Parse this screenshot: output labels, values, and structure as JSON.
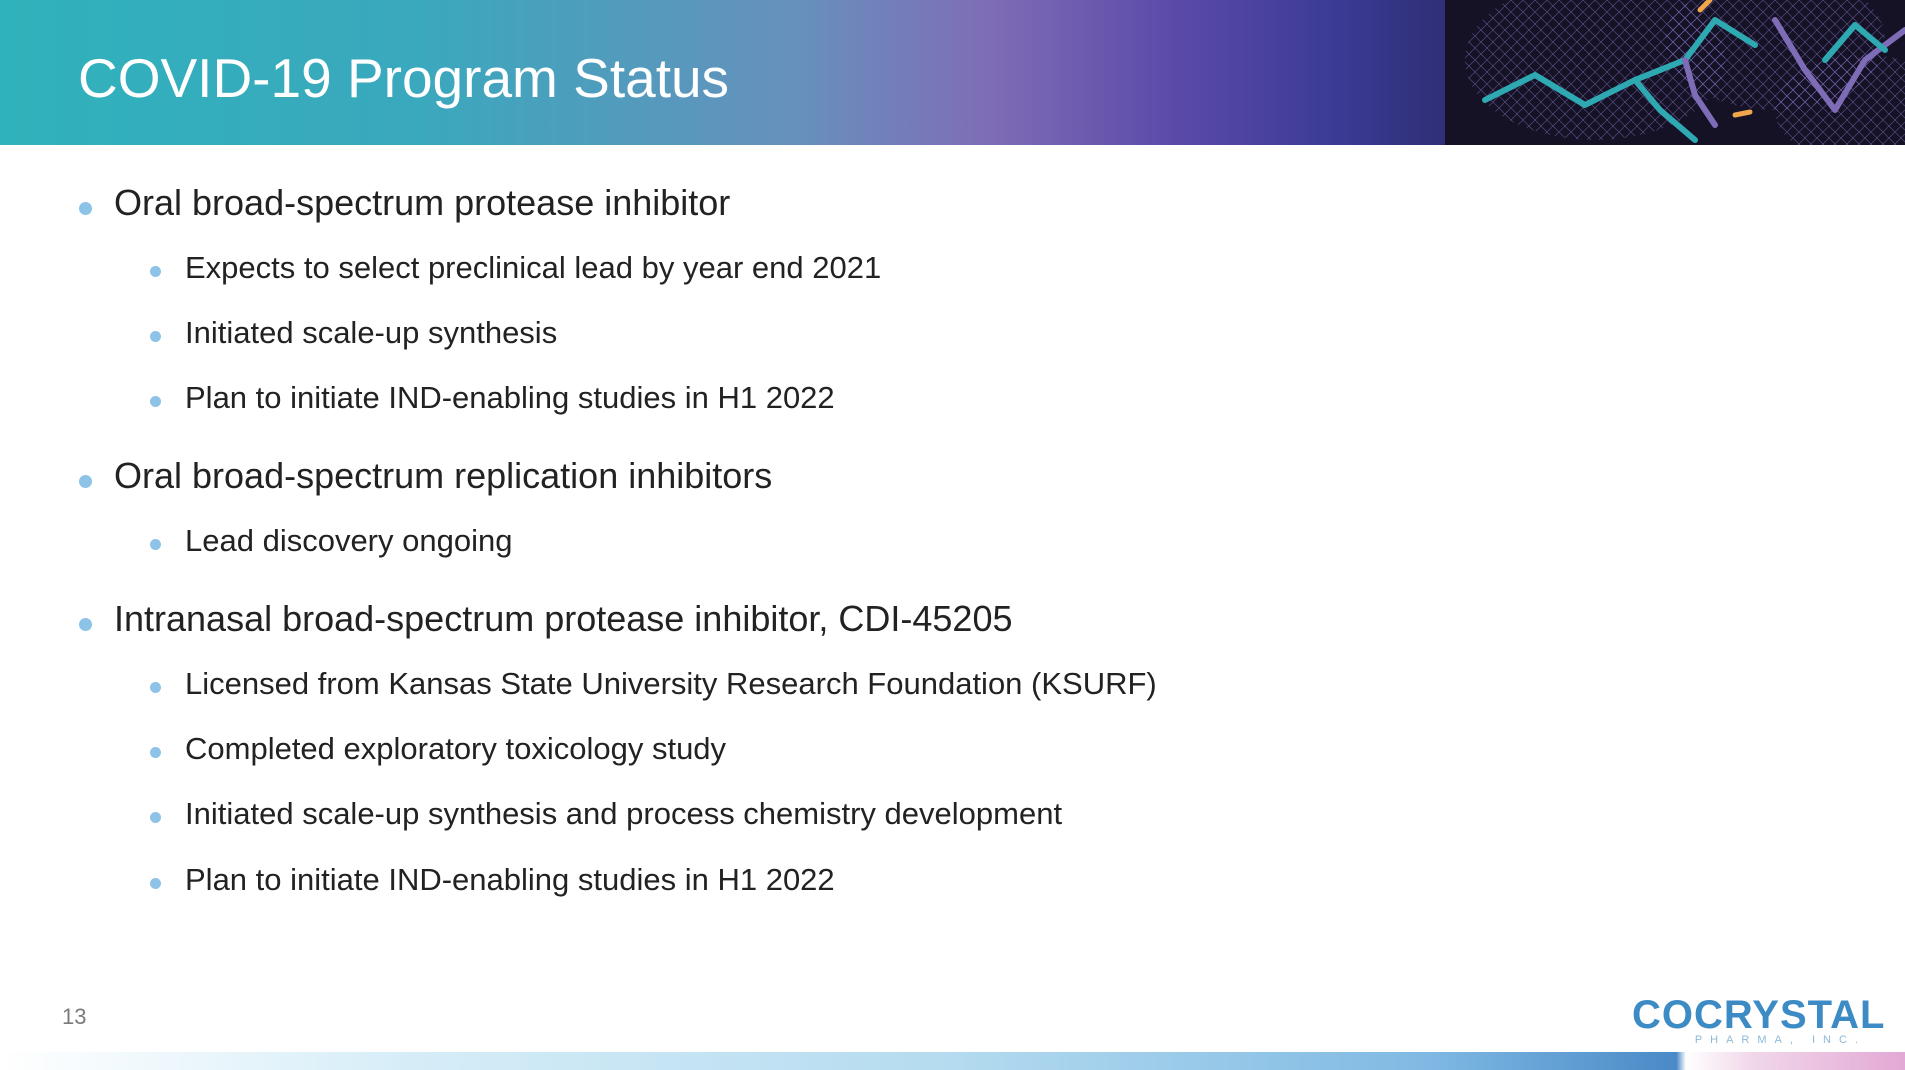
{
  "slide": {
    "title": "COVID-19 Program Status",
    "page_number": "13"
  },
  "sections": [
    {
      "heading": "Oral broad-spectrum protease inhibitor",
      "items": [
        "Expects to select preclinical lead by year end 2021",
        "Initiated scale-up synthesis",
        "Plan to initiate IND-enabling studies in H1 2022"
      ]
    },
    {
      "heading": "Oral broad-spectrum replication inhibitors",
      "items": [
        "Lead discovery ongoing"
      ]
    },
    {
      "heading": "Intranasal broad-spectrum protease inhibitor, CDI-45205",
      "items": [
        "Licensed from Kansas State University Research Foundation (KSURF)",
        "Completed exploratory toxicology study",
        "Initiated scale-up synthesis and process chemistry development",
        "Plan to initiate IND-enabling studies in H1 2022"
      ]
    }
  ],
  "logo": {
    "wordmark": "COCRYSTAL",
    "tagline": "PHARMA, INC."
  },
  "colors": {
    "bullet": "#8ec3e8",
    "logo_blue": "#3d8bc4",
    "header_teal": "#2fb2bb",
    "header_purple": "#7f6cb6"
  }
}
